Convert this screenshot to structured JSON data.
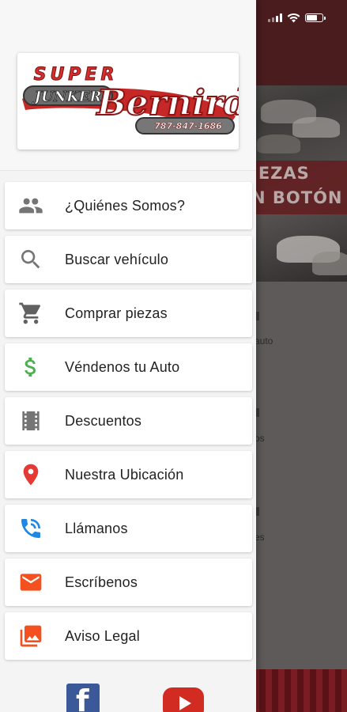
{
  "logo": {
    "line1": "SUPER",
    "line2": "JUNKER",
    "line3": "Bernird",
    "phone": "787-847-1686"
  },
  "menu": {
    "items": [
      {
        "label": "¿Quiénes Somos?",
        "icon": "group-icon",
        "color": "#757575"
      },
      {
        "label": "Buscar vehículo",
        "icon": "search-icon",
        "color": "#757575"
      },
      {
        "label": "Comprar piezas",
        "icon": "cart-icon",
        "color": "#616161"
      },
      {
        "label": "Véndenos tu Auto",
        "icon": "dollar-icon",
        "color": "#4caf50"
      },
      {
        "label": "Descuentos",
        "icon": "film-icon",
        "color": "#757575"
      },
      {
        "label": "Nuestra Ubicación",
        "icon": "location-pin-icon",
        "color": "#e53935"
      },
      {
        "label": "Llámanos",
        "icon": "phone-ring-icon",
        "color": "#1e88e5"
      },
      {
        "label": "Escríbenos",
        "icon": "mail-icon",
        "color": "#f4511e"
      },
      {
        "label": "Aviso Legal",
        "icon": "photo-library-icon",
        "color": "#f4511e"
      }
    ]
  },
  "social": {
    "facebook_glyph": "f"
  },
  "background": {
    "banner_line1": "IEZAS",
    "banner_line2": "N BOTÓN",
    "snippet1": "auto",
    "snippet2": "os",
    "snippet3": "es",
    "brand_color": "#4a1c1e"
  }
}
